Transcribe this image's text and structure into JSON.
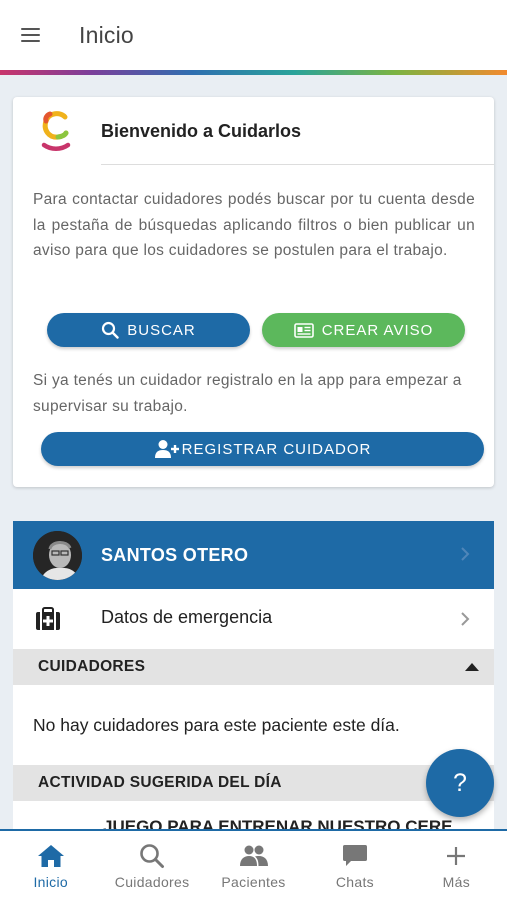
{
  "header": {
    "title": "Inicio"
  },
  "welcome": {
    "title": "Bienvenido a Cuidarlos",
    "intro": "Para contactar cuidadores podés buscar por tu cuenta desde la pestaña de búsquedas aplicando filtros o bien publicar un aviso para que los cuidadores se postulen para el trabajo.",
    "search_label": "BUSCAR",
    "create_label": "CREAR AVISO",
    "register_text": "Si ya tenés un cuidador registralo en la app para empezar a supervisar su trabajo.",
    "register_label": "REGISTRAR CUIDADOR"
  },
  "patient": {
    "name": "SANTOS OTERO",
    "emergency_label": "Datos de emergencia",
    "caregivers_header": "CUIDADORES",
    "caregivers_empty": "No hay cuidadores para este paciente este día.",
    "activity_header": "ACTIVIDAD SUGERIDA DEL DÍA",
    "activity_title": "JUEGO PARA ENTRENAR NUESTRO CERE"
  },
  "help": {
    "label": "?"
  },
  "nav": {
    "items": [
      {
        "label": "Inicio",
        "icon": "home-icon",
        "active": true
      },
      {
        "label": "Cuidadores",
        "icon": "search-icon"
      },
      {
        "label": "Pacientes",
        "icon": "people-icon"
      },
      {
        "label": "Chats",
        "icon": "chat-icon"
      },
      {
        "label": "Más",
        "icon": "plus-icon"
      }
    ]
  },
  "colors": {
    "primary": "#1e6aa6",
    "success": "#5cb85c",
    "section": "#e3e3e3"
  }
}
